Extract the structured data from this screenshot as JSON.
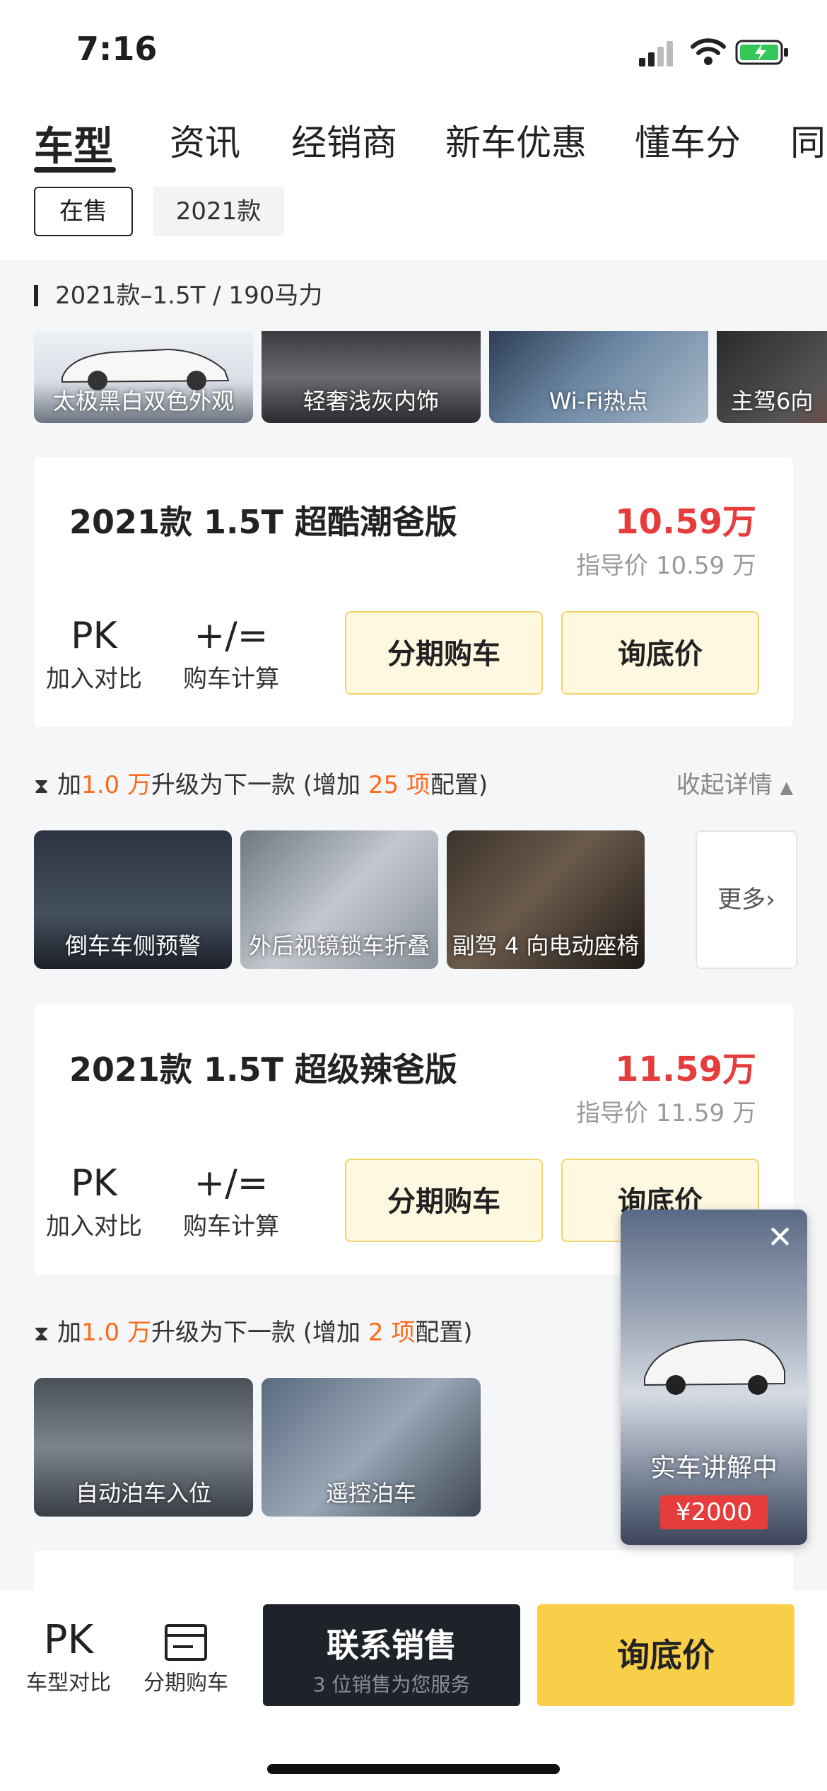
{
  "status_bar": {
    "time": "7:16"
  },
  "tabs": [
    "车型",
    "资讯",
    "经销商",
    "新车优惠",
    "懂车分",
    "同系"
  ],
  "filters": {
    "selected": "在售",
    "other": "2021款"
  },
  "section": {
    "title": "2021款–1.5T / 190马力"
  },
  "photos": [
    "太极黑白双色外观",
    "轻奢浅灰内饰",
    "Wi-Fi热点",
    "主驾6向"
  ],
  "cars": [
    {
      "name": "2021款 1.5T 超酷潮爸版",
      "price": "10.59万",
      "guide": "指导价 10.59 万",
      "pk_glyph": "PK",
      "pk_label": "加入对比",
      "calc_glyph": "+/=",
      "calc_label": "购车计算",
      "installment": "分期购车",
      "inquiry": "询底价"
    },
    {
      "name": "2021款 1.5T 超级辣爸版",
      "price": "11.59万",
      "guide": "指导价 11.59 万",
      "pk_glyph": "PK",
      "pk_label": "加入对比",
      "calc_glyph": "+/=",
      "calc_label": "购车计算",
      "installment": "分期购车",
      "inquiry": "询底价"
    }
  ],
  "upgrades": [
    {
      "prefix": "加",
      "amount": "1.0 万",
      "middle": "升级为下一款 (增加",
      "count": "25 项",
      "suffix": "配置)",
      "collapse": "收起详情",
      "features": [
        "倒车车侧预警",
        "外后视镜锁车折叠",
        "副驾 4 向电动座椅"
      ],
      "more": "更多"
    },
    {
      "prefix": "加",
      "amount": "1.0 万",
      "middle": "升级为下一款 (增加",
      "count": "2 项",
      "suffix": "配置)",
      "features": [
        "自动泊车入位",
        "遥控泊车"
      ]
    }
  ],
  "floating_video": {
    "text": "实车讲解中",
    "price": "¥2000"
  },
  "bottom_bar": {
    "compare_glyph": "PK",
    "compare_label": "车型对比",
    "installment_label": "分期购车",
    "contact_main": "联系销售",
    "contact_sub": "3 位销售为您服务",
    "inquiry": "询底价"
  }
}
